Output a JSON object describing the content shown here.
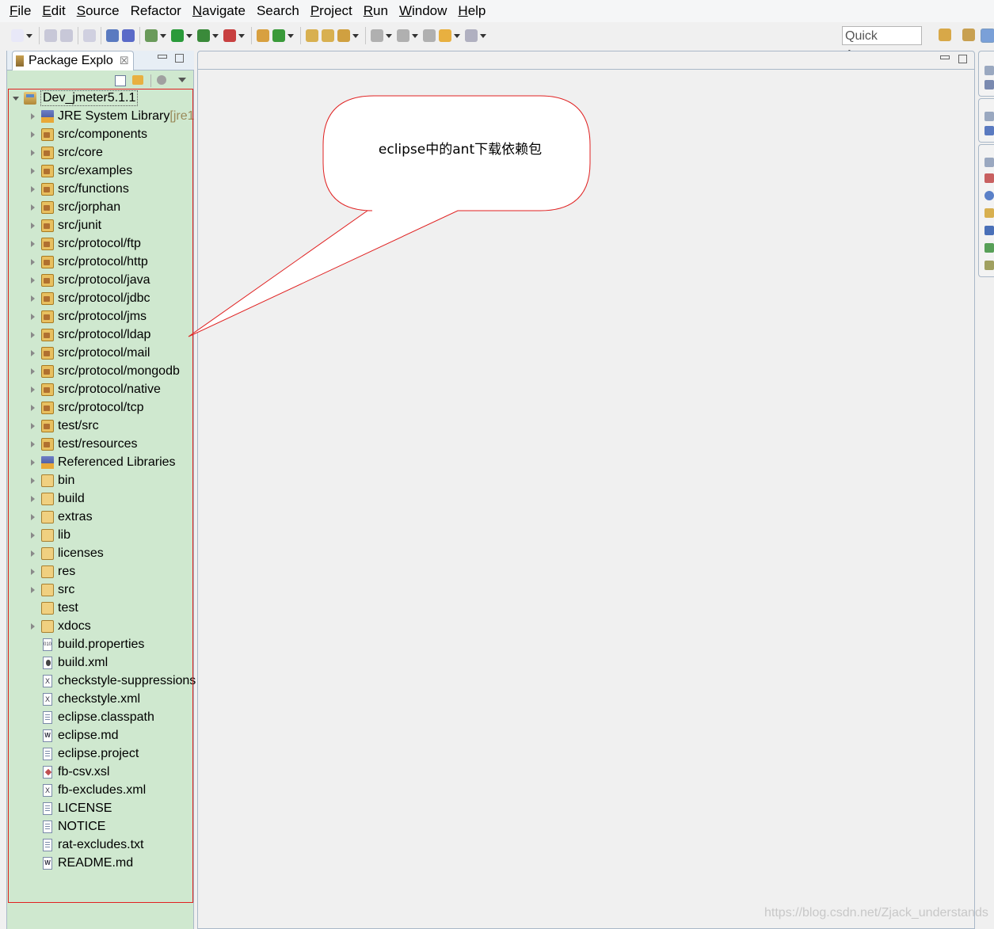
{
  "menu": [
    {
      "accel": "F",
      "rest": "ile"
    },
    {
      "accel": "E",
      "rest": "dit"
    },
    {
      "accel": "S",
      "rest": "ource"
    },
    {
      "accel": "",
      "rest": "Refactor"
    },
    {
      "accel": "N",
      "rest": "avigate"
    },
    {
      "accel": "",
      "rest": "Search"
    },
    {
      "accel": "P",
      "rest": "roject"
    },
    {
      "accel": "R",
      "rest": "un"
    },
    {
      "accel": "W",
      "rest": "indow"
    },
    {
      "accel": "H",
      "rest": "elp"
    }
  ],
  "quick_access": "Quick Access",
  "package_explorer": {
    "tab_label": "Package Explo",
    "close_glyph": "☒",
    "project": "Dev_jmeter5.1.1",
    "items": [
      {
        "label": "JRE System Library",
        "suffix": " [jre1",
        "icon": "library-icon"
      },
      {
        "label": "src/components",
        "icon": "source-folder-icon"
      },
      {
        "label": "src/core",
        "icon": "source-folder-icon"
      },
      {
        "label": "src/examples",
        "icon": "source-folder-icon"
      },
      {
        "label": "src/functions",
        "icon": "source-folder-icon"
      },
      {
        "label": "src/jorphan",
        "icon": "source-folder-icon"
      },
      {
        "label": "src/junit",
        "icon": "source-folder-icon"
      },
      {
        "label": "src/protocol/ftp",
        "icon": "source-folder-icon"
      },
      {
        "label": "src/protocol/http",
        "icon": "source-folder-icon"
      },
      {
        "label": "src/protocol/java",
        "icon": "source-folder-icon"
      },
      {
        "label": "src/protocol/jdbc",
        "icon": "source-folder-icon"
      },
      {
        "label": "src/protocol/jms",
        "icon": "source-folder-icon"
      },
      {
        "label": "src/protocol/ldap",
        "icon": "source-folder-icon"
      },
      {
        "label": "src/protocol/mail",
        "icon": "source-folder-icon"
      },
      {
        "label": "src/protocol/mongodb",
        "icon": "source-folder-icon"
      },
      {
        "label": "src/protocol/native",
        "icon": "source-folder-icon"
      },
      {
        "label": "src/protocol/tcp",
        "icon": "source-folder-icon"
      },
      {
        "label": "test/src",
        "icon": "source-folder-icon"
      },
      {
        "label": "test/resources",
        "icon": "source-folder-icon"
      },
      {
        "label": "Referenced Libraries",
        "icon": "library-icon"
      },
      {
        "label": "bin",
        "icon": "folder-icon"
      },
      {
        "label": "build",
        "icon": "folder-icon"
      },
      {
        "label": "extras",
        "icon": "folder-icon"
      },
      {
        "label": "lib",
        "icon": "folder-icon"
      },
      {
        "label": "licenses",
        "icon": "folder-icon"
      },
      {
        "label": "res",
        "icon": "folder-icon"
      },
      {
        "label": "src",
        "icon": "folder-icon"
      },
      {
        "label": "test",
        "icon": "folder-icon",
        "noTwisty": true
      },
      {
        "label": "xdocs",
        "icon": "folder-icon"
      },
      {
        "label": "build.properties",
        "icon": "properties-file-icon",
        "noTwisty": true
      },
      {
        "label": "build.xml",
        "icon": "ant-file-icon",
        "noTwisty": true
      },
      {
        "label": "checkstyle-suppressions",
        "icon": "xml-file-icon",
        "noTwisty": true
      },
      {
        "label": "checkstyle.xml",
        "icon": "xml-file-icon",
        "noTwisty": true
      },
      {
        "label": "eclipse.classpath",
        "icon": "text-file-icon",
        "noTwisty": true
      },
      {
        "label": "eclipse.md",
        "icon": "markdown-file-icon",
        "noTwisty": true
      },
      {
        "label": "eclipse.project",
        "icon": "text-file-icon",
        "noTwisty": true
      },
      {
        "label": "fb-csv.xsl",
        "icon": "xsl-file-icon",
        "noTwisty": true
      },
      {
        "label": "fb-excludes.xml",
        "icon": "xml-file-icon",
        "noTwisty": true
      },
      {
        "label": "LICENSE",
        "icon": "text-file-icon",
        "noTwisty": true
      },
      {
        "label": "NOTICE",
        "icon": "text-file-icon",
        "noTwisty": true
      },
      {
        "label": "rat-excludes.txt",
        "icon": "text-file-icon",
        "noTwisty": true
      },
      {
        "label": "README.md",
        "icon": "markdown-file-icon",
        "noTwisty": true
      }
    ]
  },
  "callout": {
    "text": "eclipse中的ant下载依赖包",
    "border_color": "#e02020"
  },
  "watermark": "https://blog.csdn.net/Zjack_understands"
}
